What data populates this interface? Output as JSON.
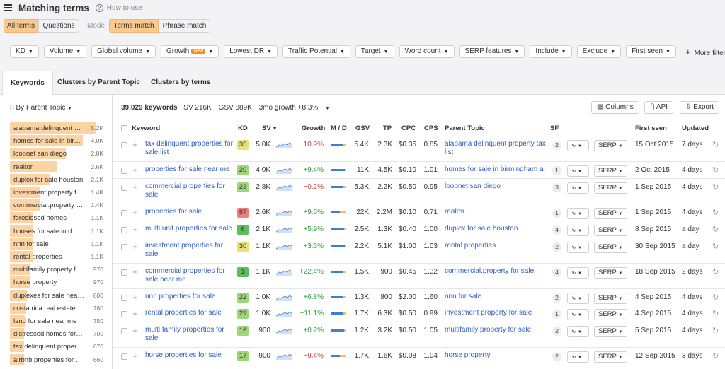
{
  "header": {
    "title": "Matching terms",
    "help_link": "How to use"
  },
  "mode_row": {
    "all_terms": "All terms",
    "questions": "Questions",
    "mode_label": "Mode",
    "terms_match": "Terms match",
    "phrase_match": "Phrase match"
  },
  "filters": [
    "KD",
    "Volume",
    "Global volume",
    "Growth",
    "Lowest DR",
    "Traffic Potential",
    "Target",
    "Word count",
    "SERP features",
    "Include",
    "Exclude",
    "First seen"
  ],
  "growth_badge": "New",
  "more_filters": "More filters",
  "tabs": [
    "Keywords",
    "Clusters by Parent Topic",
    "Clusters by terms"
  ],
  "left": {
    "group_by": "By Parent Topic",
    "items": [
      {
        "label": "alabama delinquent property tax list",
        "value": "5.2K",
        "fill": 0.9
      },
      {
        "label": "homes for sale in birmingham al",
        "value": "4.0K",
        "fill": 0.76
      },
      {
        "label": "loopnet san diego",
        "value": "2.8K",
        "fill": 0.58
      },
      {
        "label": "realtor",
        "value": "2.6K",
        "fill": 0.49
      },
      {
        "label": "duplex for sale houston",
        "value": "2.1K",
        "fill": 0.42
      },
      {
        "label": "investment property for sale",
        "value": "1.4K",
        "fill": 0.31
      },
      {
        "label": "commercial.property for sale",
        "value": "1.4K",
        "fill": 0.31
      },
      {
        "label": "foreclosed homes",
        "value": "1.1K",
        "fill": 0.24
      },
      {
        "label": "houses for sale in d...",
        "value": "1.1K",
        "fill": 0.24
      },
      {
        "label": "nnn for sale",
        "value": "1.1K",
        "fill": 0.24
      },
      {
        "label": "rental properties",
        "value": "1.1K",
        "fill": 0.24
      },
      {
        "label": "multifamily property for sale",
        "value": "970",
        "fill": 0.21
      },
      {
        "label": "horse property",
        "value": "970",
        "fill": 0.21
      },
      {
        "label": "duplexes for sale near me",
        "value": "800",
        "fill": 0.18
      },
      {
        "label": "costa rica real estate",
        "value": "780",
        "fill": 0.17
      },
      {
        "label": "land for sale near me",
        "value": "750",
        "fill": 0.16
      },
      {
        "label": "distressed homes for sale",
        "value": "700",
        "fill": 0.15
      },
      {
        "label": "tax delinquent properties",
        "value": "670",
        "fill": 0.15
      },
      {
        "label": "airbnb properties for sale",
        "value": "660",
        "fill": 0.15
      }
    ]
  },
  "summary": {
    "count": "39,029 keywords",
    "sv": "SV 216K",
    "gsv": "GSV 889K",
    "growth": "3mo growth +8.3%"
  },
  "actions": {
    "columns": "Columns",
    "api": "API",
    "export": "Export"
  },
  "columns": {
    "keyword": "Keyword",
    "kd": "KD",
    "sv": "SV",
    "growth": "Growth",
    "md": "M / D",
    "gsv": "GSV",
    "tp": "TP",
    "cpc": "CPC",
    "cps": "CPS",
    "parent": "Parent Topic",
    "sf": "SF",
    "first": "First seen",
    "updated": "Updated"
  },
  "colors": {
    "kd_green": "#9fd67b",
    "kd_yellow": "#e8e07a",
    "kd_red": "#f07c7c",
    "kd_darkgreen": "#5cbf5c",
    "pos": "#2a9a3c",
    "neg": "#d23b3b",
    "link": "#2f5fbf",
    "accent": "#fbc98d"
  },
  "serp_label": "SERP",
  "rows": [
    {
      "kw": "tax delinquent properties for sale list",
      "kd": "35",
      "kdc": "yellow",
      "sv": "5.0K",
      "growth": "−10.9%",
      "neg": true,
      "m": 0.8,
      "gsv": "5.4K",
      "tp": "2.3K",
      "cpc": "$0.35",
      "cps": "0.85",
      "pt": "alabama delinquent property tax list",
      "sf": "2",
      "first": "15 Oct 2015",
      "upd": "7 days"
    },
    {
      "kw": "properties for sale near me",
      "kd": "20",
      "kdc": "green",
      "sv": "4.0K",
      "growth": "+9.4%",
      "neg": false,
      "m": 0.9,
      "gsv": "11K",
      "tp": "4.5K",
      "cpc": "$0.10",
      "cps": "1.01",
      "pt": "homes for sale in birmingham al",
      "sf": "1",
      "first": "2 Oct 2015",
      "upd": "4 days"
    },
    {
      "kw": "commercial properties for sale",
      "kd": "23",
      "kdc": "green",
      "sv": "2.8K",
      "growth": "−0.2%",
      "neg": true,
      "m": 0.75,
      "gsv": "5.3K",
      "tp": "2.2K",
      "cpc": "$0.50",
      "cps": "0.95",
      "pt": "loopnet san diego",
      "sf": "3",
      "first": "1 Sep 2015",
      "upd": "4 days"
    },
    {
      "kw": "properties for sale",
      "kd": "87",
      "kdc": "red",
      "sv": "2.6K",
      "growth": "+9.5%",
      "neg": false,
      "m": 0.6,
      "gsv": "22K",
      "tp": "2.2M",
      "cpc": "$0.10",
      "cps": "0.71",
      "pt": "realtor",
      "sf": "1",
      "first": "1 Sep 2015",
      "upd": "4 days"
    },
    {
      "kw": "multi unit properties for sale",
      "kd": "6",
      "kdc": "darkgreen",
      "sv": "2.1K",
      "growth": "+5.9%",
      "neg": false,
      "m": 0.85,
      "gsv": "2.5K",
      "tp": "1.3K",
      "cpc": "$0.40",
      "cps": "1.00",
      "pt": "duplex for sale houston",
      "sf": "4",
      "first": "8 Sep 2015",
      "upd": "a day"
    },
    {
      "kw": "investment properties for sale",
      "kd": "30",
      "kdc": "yellow",
      "sv": "1.1K",
      "growth": "+3.6%",
      "neg": false,
      "m": 0.9,
      "gsv": "2.2K",
      "tp": "5.1K",
      "cpc": "$1.00",
      "cps": "1.03",
      "pt": "rental properties",
      "sf": "2",
      "first": "30 Sep 2015",
      "upd": "a day"
    },
    {
      "kw": "commercial properties for sale near me",
      "kd": "1",
      "kdc": "darkgreen",
      "sv": "1.1K",
      "growth": "+22.4%",
      "neg": false,
      "m": 0.75,
      "gsv": "1.5K",
      "tp": "900",
      "cpc": "$0.45",
      "cps": "1.32",
      "pt": "commercial.property for sale",
      "sf": "4",
      "first": "18 Sep 2015",
      "upd": "2 days"
    },
    {
      "kw": "nnn properties for sale",
      "kd": "22",
      "kdc": "green",
      "sv": "1.0K",
      "growth": "+6.8%",
      "neg": false,
      "m": 0.8,
      "gsv": "1.3K",
      "tp": "800",
      "cpc": "$2.00",
      "cps": "1.60",
      "pt": "nnn for sale",
      "sf": "2",
      "first": "4 Sep 2015",
      "upd": "4 days"
    },
    {
      "kw": "rental properties for sale",
      "kd": "29",
      "kdc": "green",
      "sv": "1.0K",
      "growth": "+11.1%",
      "neg": false,
      "m": 0.75,
      "gsv": "1.7K",
      "tp": "6.3K",
      "cpc": "$0.50",
      "cps": "0.99",
      "pt": "investment property for sale",
      "sf": "1",
      "first": "4 Sep 2015",
      "upd": "4 days"
    },
    {
      "kw": "multi family properties for sale",
      "kd": "16",
      "kdc": "green",
      "sv": "900",
      "growth": "+0.2%",
      "neg": false,
      "m": 0.85,
      "gsv": "1.2K",
      "tp": "3.2K",
      "cpc": "$0.50",
      "cps": "1.05",
      "pt": "multifamily property for sale",
      "sf": "2",
      "first": "5 Sep 2015",
      "upd": "4 days"
    },
    {
      "kw": "horse properties for sale",
      "kd": "17",
      "kdc": "green",
      "sv": "900",
      "growth": "−9.4%",
      "neg": true,
      "m": 0.6,
      "gsv": "1.7K",
      "tp": "1.6K",
      "cpc": "$0.08",
      "cps": "1.04",
      "pt": "horse property",
      "sf": "2",
      "first": "12 Sep 2015",
      "upd": "3 days"
    }
  ]
}
